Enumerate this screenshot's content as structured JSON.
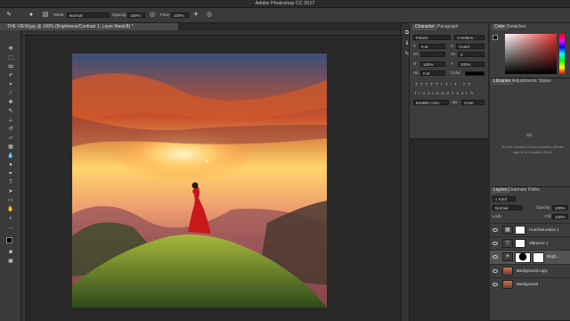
{
  "app": {
    "window_title": "Adobe Photoshop CC 2017",
    "document_tab": "THE VIEW.jpg @ 100% (Brightness/Contrast 1, Layer Mask/8) *"
  },
  "options_bar": {
    "mode_label": "Mode:",
    "mode_value": "Normal",
    "opacity_label": "Opacity:",
    "opacity_value": "100%",
    "flow_label": "Flow:",
    "flow_value": "100%"
  },
  "character_panel": {
    "tabs": [
      "Character",
      "Paragraph"
    ],
    "font_family": "Futura",
    "font_style": "Condens...",
    "font_size": "9 pt",
    "leading": "(Auto)",
    "kerning": "VA",
    "tracking": "0",
    "vertical_scale": "100%",
    "horizontal_scale": "100%",
    "baseline_shift": "0 pt",
    "color_label": "Color:",
    "language": "English: USA",
    "aa_label": "aa",
    "antialias": "Crisp",
    "style_buttons": [
      "T",
      "T",
      "TT",
      "Tт",
      "T¹",
      "T,",
      "T",
      "T"
    ],
    "opentype_buttons": [
      "fi",
      "ơ",
      "st",
      "A",
      "ad",
      "T",
      "1st",
      "½"
    ]
  },
  "color_panel": {
    "tabs": [
      "Color",
      "Swatches"
    ],
    "hue_color": "#e63030"
  },
  "libraries_panel": {
    "tabs": [
      "Libraries",
      "Adjustments",
      "Styles"
    ],
    "message": "To use Creative Cloud Libraries, please sign in to Creative Cloud"
  },
  "layers_panel": {
    "tabs": [
      "Layers",
      "Channels",
      "Paths"
    ],
    "filter_kind": "Kind",
    "blend_mode": "Normal",
    "opacity_label": "Opacity:",
    "opacity_value": "100%",
    "lock_label": "Lock:",
    "fill_label": "Fill:",
    "fill_value": "100%",
    "layers": [
      {
        "name": "Hue/Saturation 1",
        "type": "adjustment",
        "selected": false
      },
      {
        "name": "Vibrance 1",
        "type": "adjustment",
        "selected": false
      },
      {
        "name": "Brigh...",
        "type": "adjustment",
        "selected": true
      },
      {
        "name": "Background copy",
        "type": "image",
        "selected": false
      },
      {
        "name": "Background",
        "type": "image",
        "selected": false
      }
    ]
  },
  "toolbar": {
    "tools": [
      "move-tool",
      "marquee-tool",
      "lasso-tool",
      "quick-select-tool",
      "crop-tool",
      "eyedropper-tool",
      "healing-brush-tool",
      "brush-tool",
      "clone-stamp-tool",
      "history-brush-tool",
      "eraser-tool",
      "gradient-tool",
      "blur-tool",
      "dodge-tool",
      "pen-tool",
      "type-tool",
      "path-select-tool",
      "shape-tool",
      "hand-tool",
      "zoom-tool",
      "more-tools",
      "color-swatches",
      "quick-mask",
      "screen-mode"
    ]
  }
}
